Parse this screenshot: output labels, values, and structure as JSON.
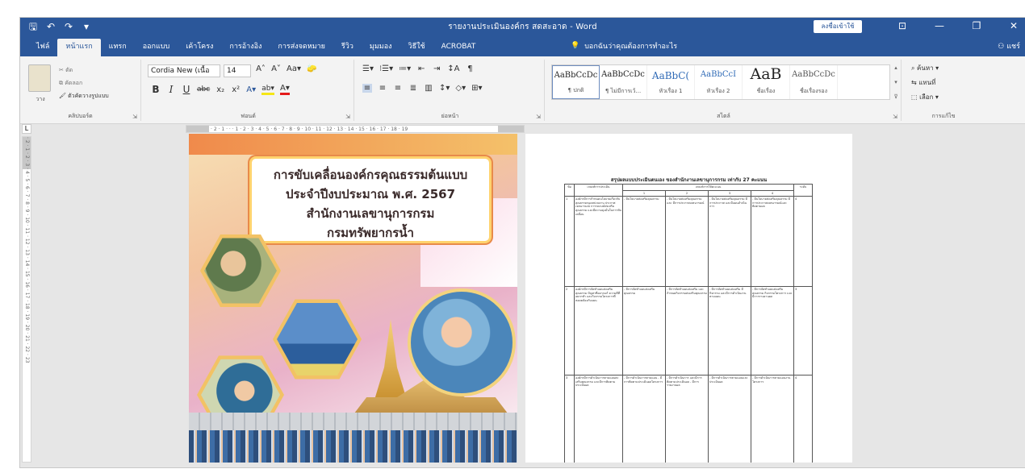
{
  "titlebar": {
    "doc_title": "รายงานประเมินองค์กร สดสะอาด - Word",
    "sign_in": "ลงชื่อเข้าใช้",
    "qat": [
      "🖫",
      "↶",
      "↷",
      "▾"
    ],
    "window_controls": [
      "⊡",
      "—",
      "❐",
      "✕"
    ]
  },
  "tabs": [
    "ไฟล์",
    "หน้าแรก",
    "แทรก",
    "ออกแบบ",
    "เค้าโครง",
    "การอ้างอิง",
    "การส่งจดหมาย",
    "รีวิว",
    "มุมมอง",
    "วิธีใช้",
    "ACROBAT"
  ],
  "active_tab": 1,
  "tell_me": "บอกฉันว่าคุณต้องการทำอะไร",
  "share": "แชร์",
  "ribbon": {
    "clipboard": {
      "paste": "วาง",
      "cut": "ตัด",
      "copy": "คัดลอก",
      "format_painter": "ตัวคัดวางรูปแบบ",
      "label": "คลิปบอร์ด"
    },
    "font": {
      "family": "Cordia New (เนื้อ",
      "size": "14",
      "label": "ฟอนต์",
      "row1": [
        "A˄",
        "A˅",
        "Aa▾",
        "🧽"
      ],
      "row2_bold": "B",
      "row2_italic": "I",
      "row2_underline": "U",
      "row2_strike": "abc",
      "row2_sub": "x₂",
      "row2_sup": "x²",
      "row2_effects": "A▾",
      "row2_highlight": "ab▾",
      "row2_color": "A▾"
    },
    "paragraph": {
      "label": "ย่อหน้า",
      "row1": [
        "☰▾",
        "⁝☰▾",
        "≔▾",
        "⇤",
        "⇥",
        "↕A",
        "¶"
      ],
      "row2": [
        "≡",
        "≡",
        "≡",
        "≣",
        "▥",
        "↕▾",
        "◇▾",
        "⊞▾"
      ]
    },
    "styles": {
      "label": "สไตล์",
      "items": [
        {
          "sample": "AaBbCcDc",
          "name": "¶ ปกติ",
          "kind": "normal"
        },
        {
          "sample": "AaBbCcDc",
          "name": "¶ ไม่มีการเว้...",
          "kind": "normal"
        },
        {
          "sample": "AaBbC(",
          "name": "หัวเรื่อง 1",
          "kind": "hd"
        },
        {
          "sample": "AaBbCcI",
          "name": "หัวเรื่อง 2",
          "kind": "hd2"
        },
        {
          "sample": "AaB",
          "name": "ชื่อเรื่อง",
          "kind": "big"
        },
        {
          "sample": "AaBbCcDc",
          "name": "ชื่อเรื่องรอง",
          "kind": "sub"
        }
      ],
      "scroll": [
        "▴",
        "▾",
        "⊽"
      ]
    },
    "editing": {
      "label": "การแก้ไข",
      "find": "⌕ ค้นหา ▾",
      "replace": "⇆ แทนที่",
      "select": "⬚ เลือก ▾"
    }
  },
  "ruler_h": "· 2 · 1 · · · 1 · 2 · 3 · 4 · 5 · 6 · 7 · 8 · 9 · 10 · 11 · 12 · 13 · 14 · 15 · 16 · 17 · 18 · 19",
  "ruler_v": "· 2 · 1 · 2 · 3 · 4 · 5 · 6 · 7 · 8 · 9 · 10 · 11 · 12 · 13 · 14 · 15 · 16 · 17 · 18 · 19 · 20 · 21 · 22 · 23",
  "ruler_corner": "L",
  "cover": {
    "line1": "การขับเคลื่อนองค์กรคุณธรรมต้นแบบ",
    "line2": "ประจำปีงบประมาณ พ.ศ. 2567",
    "line3": "สำนักงานเลขานุการกรม",
    "line4": "กรมทรัพยากรน้ำ"
  },
  "page2": {
    "title": "สรุปผลแบบประเมินตนเอง ของสำนักงานเลขานุการกรม เท่ากับ 27 คะแนน",
    "head": [
      "ข้อ",
      "เกณฑ์การประเมิน",
      "เกณฑ์การให้คะแนน",
      "ระดับ"
    ],
    "levels": [
      "1",
      "2",
      "3",
      "4"
    ],
    "rows": [
      {
        "no": "1",
        "criteria": "องค์กรมีการกำหนดนโยบายเกี่ยวกับคุณธรรมของหน่วยงาน ประกาศเจตนารมณ์ การรณรงค์ส่งเสริม คุณธรรม และมีความมุ่งมั่นในการขับเคลื่อน",
        "c1": "- มีนโยบายส่งเสริมคุณธรรม",
        "c2": "- มีนโยบายส่งเสริมคุณธรรม และ มีการประกาศเจตนารมณ์",
        "c3": "- มีนโยบายส่งเสริมคุณธรรม มีการประกาศ และมีแผนดำเนินการ",
        "c4": "- มีนโยบายส่งเสริมคุณธรรม มีการประกาศเจตนารมณ์และติดตามผล",
        "score": "4"
      },
      {
        "no": "2",
        "criteria": "องค์กรมีการจัดทำแผนส่งเสริมคุณธรรม ปัญหาที่อยากแก้ ความดีที่อยากทำ และกิจกรรมโครงการที่สอดคล้องกับแผน",
        "c1": "- มีการจัดทำแผนส่งเสริมคุณธรรม",
        "c2": "- มีการจัดทำแผนส่งเสริม และกำหนดกิจกรรมส่งเสริมคุณธรรม",
        "c3": "- มีการจัดทำแผนส่งเสริม มีกิจกรรม และมีการดำเนินงานตามแผน",
        "c4": "- มีการจัดทำแผนส่งเสริมคุณธรรม กิจกรรมโครงการ และมีการรายงานผล",
        "score": "3"
      },
      {
        "no": "3",
        "criteria": "องค์กรมีการดำเนินการตามแผนส่งเสริมคุณธรรม และมีการติดตามประเมินผล",
        "c1": "- มีการดำเนินการตามแผน - มีการติดตามประเมินผลโครงการ",
        "c2": "- มีการดำเนินการ และมีการติดตามประเมินผล - มีการรายงานผล",
        "c3": "- มีการดำเนินการตามแผนและประเมินผล",
        "c4": "- มีการดำเนินการตามแผนงานโครงการ",
        "score": "4"
      }
    ]
  },
  "colors": {
    "brand": "#2b579a",
    "ribbon": "#f3f3f3",
    "canvas": "#e6e6e6"
  }
}
